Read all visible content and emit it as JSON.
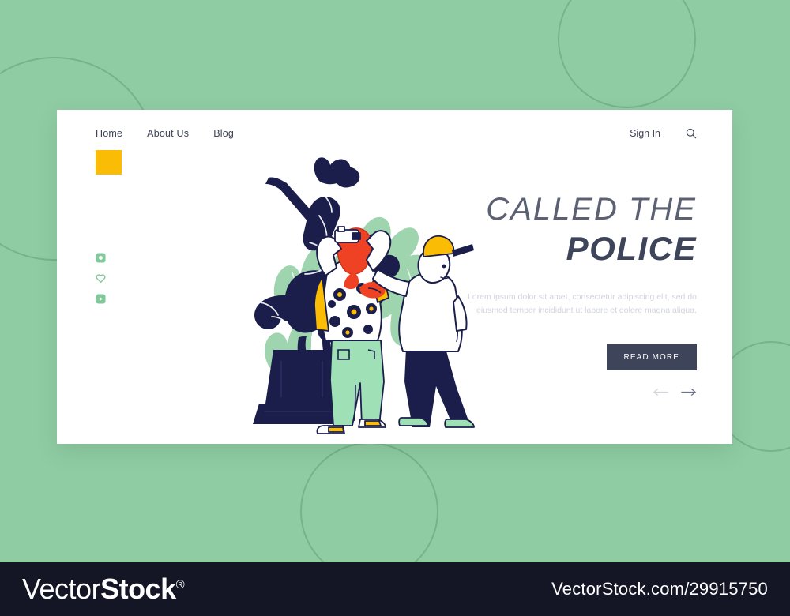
{
  "theme": {
    "page_bg": "#8fcca3",
    "card_bg": "#ffffff",
    "accent_yellow": "#fbbc05",
    "navy": "#3e4459",
    "footer_bg": "#141626",
    "social_green": "#7fc99a",
    "muted_text": "#d2d4dc"
  },
  "nav": {
    "links": [
      {
        "label": "Home"
      },
      {
        "label": "About Us"
      },
      {
        "label": "Blog"
      }
    ],
    "sign_in": "Sign In",
    "search_icon": "search-icon"
  },
  "social": {
    "items": [
      {
        "icon": "instagram-icon"
      },
      {
        "icon": "heart-icon"
      },
      {
        "icon": "video-play-icon"
      }
    ]
  },
  "hero": {
    "title_line1": "CALLED THE",
    "title_line2": "POLICE",
    "description": "Lorem ipsum dolor sit amet, consectetur adipiscing elit, sed do eiusmod tempor incididunt ut labore et dolore magna aliqua.",
    "cta_label": "READ MORE",
    "prev_arrow": "arrow-left-icon",
    "next_arrow": "arrow-right-icon"
  },
  "illustration": {
    "name": "statue-vandalism-illustration",
    "description": "Equestrian statue being spray painted by a character while another character pulls them away"
  },
  "footer": {
    "brand_light": "Vector",
    "brand_bold": "Stock",
    "brand_reg": "®",
    "url": "VectorStock.com/29915750"
  }
}
